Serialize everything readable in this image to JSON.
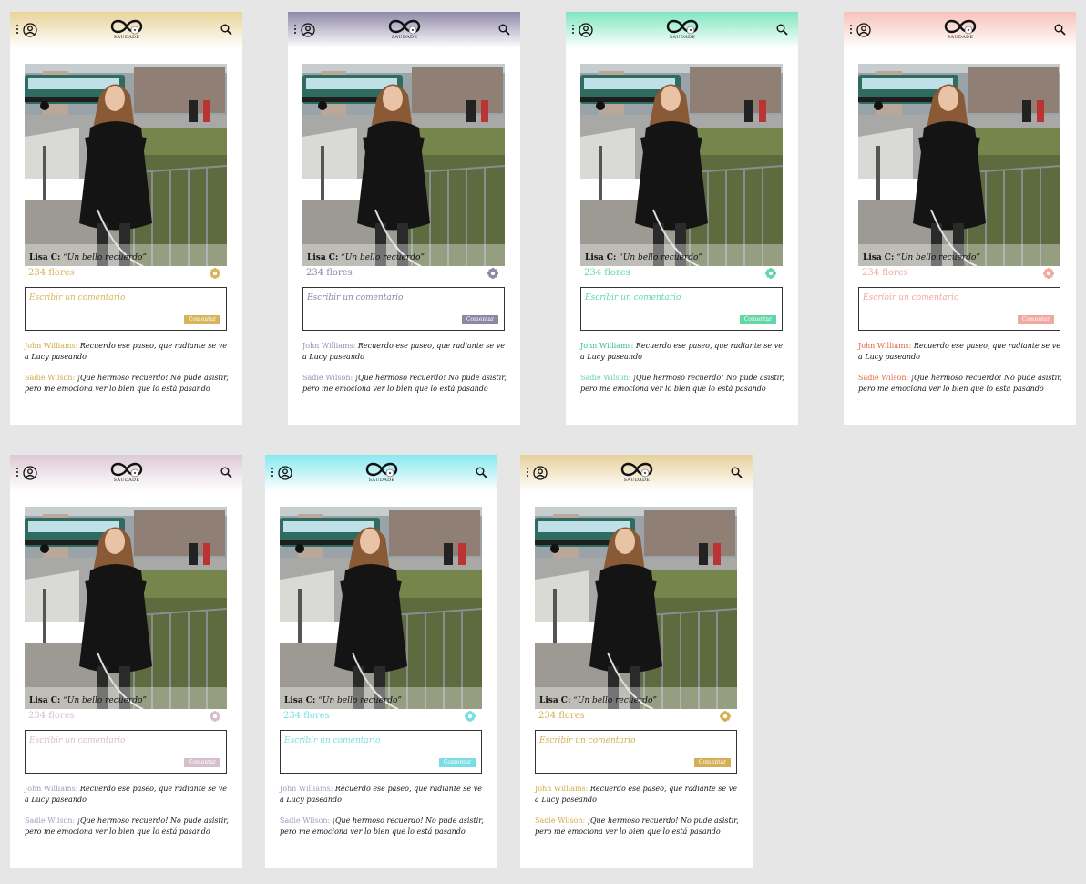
{
  "app": {
    "logo_text": "SAUDADE"
  },
  "post": {
    "caption_author": "Lisa C:",
    "caption_text": "“Un bello recuerdo”",
    "flowers": "234 flores",
    "comment_placeholder": "Escribir un comentario",
    "comment_button": "Comentar"
  },
  "comments": [
    {
      "author": "John Williams:",
      "text": "Recuerdo ese paseo, que radiante se ve a Lucy paseando"
    },
    {
      "author": "Sadie Wilson:",
      "text": "¡Que hermoso recuerdo! No pude asistir, pero me emociona ver lo bien que lo está pasando"
    }
  ],
  "variants": [
    {
      "accent": "#d8b45a",
      "header_color": "#e9d39a",
      "comment1_color": "#d2a944",
      "comment2_color": "#d2a944"
    },
    {
      "accent": "#8d86a6",
      "header_color": "#8f88a8",
      "comment1_color": "#9b8cb3",
      "comment2_color": "#9b8cb3"
    },
    {
      "accent": "#63d6a6",
      "header_color": "#7fe6c0",
      "comment1_color": "#2ebf85",
      "comment2_color": "#5fd3a0"
    },
    {
      "accent": "#f0a8a0",
      "header_color": "#f6c2bb",
      "comment1_color": "#e2663f",
      "comment2_color": "#e2663f"
    },
    {
      "accent": "#d6bfcc",
      "header_color": "#dcc9d3",
      "comment1_color": "#a897c2",
      "comment2_color": "#a897c2"
    },
    {
      "accent": "#79dde3",
      "header_color": "#86e9ef",
      "comment1_color": "#a897c2",
      "comment2_color": "#a897c2"
    },
    {
      "accent": "#d6ae55",
      "header_color": "#e6d09a",
      "comment1_color": "#d2a944",
      "comment2_color": "#d2a944"
    }
  ]
}
